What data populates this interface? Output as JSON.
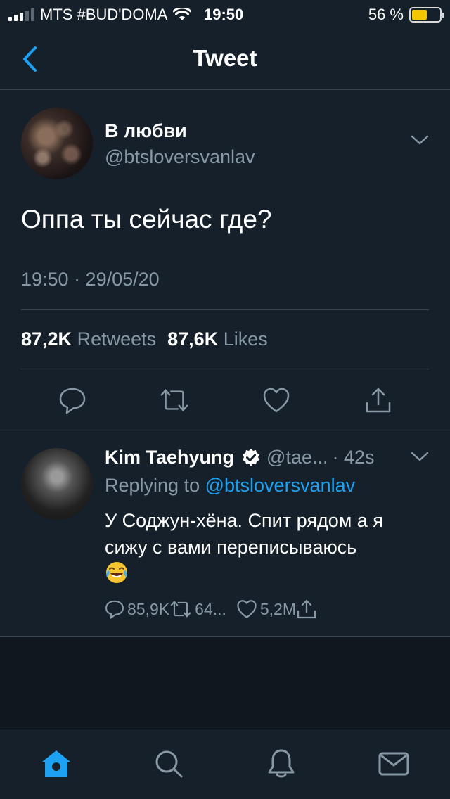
{
  "status_bar": {
    "carrier": "MTS #BUD'DOMA",
    "time": "19:50",
    "battery_percent": "56 %",
    "battery_level": 0.56
  },
  "nav": {
    "title": "Tweet"
  },
  "tweet": {
    "author_name": "В любви",
    "author_handle": "@btsloversvanlav",
    "text": "Оппа ты сейчас где?",
    "timestamp": "19:50 · 29/05/20",
    "retweets_count": "87,2K",
    "retweets_label": "Retweets",
    "likes_count": "87,6K",
    "likes_label": "Likes"
  },
  "reply": {
    "author_name": "Kim Taehyung",
    "author_handle": "@tae...",
    "time": "· 42s",
    "replying_label": "Replying to",
    "replying_mention": "@btsloversvanlav",
    "text": "У Соджун-хёна. Спит рядом а я сижу с вами переписываюсь",
    "emoji": "face-with-tears-of-joy",
    "reply_count": "85,9K",
    "retweet_count": "64...",
    "like_count": "5,2M"
  },
  "tabs": [
    "home",
    "search",
    "notifications",
    "messages"
  ],
  "colors": {
    "background": "#15202b",
    "accent": "#1da1f2",
    "muted": "#8899a6",
    "divider": "#38444d"
  }
}
